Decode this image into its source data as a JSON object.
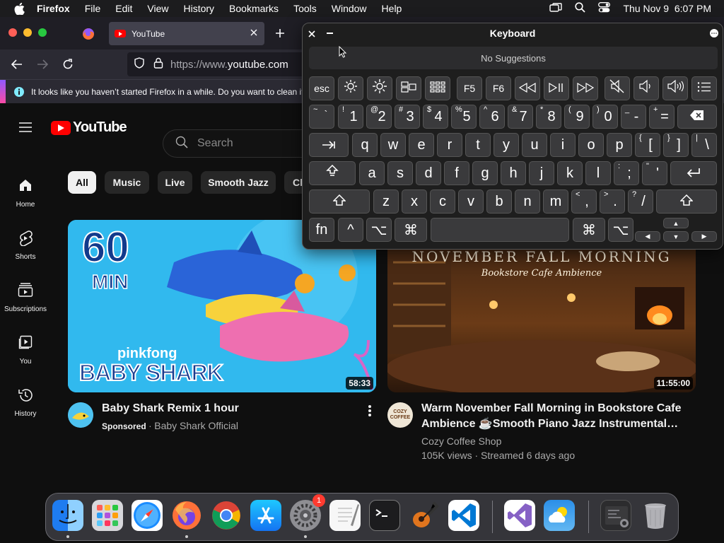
{
  "menubar": {
    "items": [
      "Firefox",
      "File",
      "Edit",
      "View",
      "History",
      "Bookmarks",
      "Tools",
      "Window",
      "Help"
    ],
    "clock": "Thu Nov 9  6:07 PM"
  },
  "browser": {
    "tab_title": "YouTube",
    "url_prefix": "https://www.",
    "url_domain": "youtube.com",
    "notification": "It looks like you haven’t started Firefox in a while. Do you want to clean it"
  },
  "youtube": {
    "logo_text": "YouTube",
    "search_placeholder": "Search",
    "sidebar": [
      {
        "label": "Home",
        "icon": "home-icon"
      },
      {
        "label": "Shorts",
        "icon": "shorts-icon"
      },
      {
        "label": "Subscriptions",
        "icon": "subscriptions-icon"
      },
      {
        "label": "You",
        "icon": "you-icon"
      },
      {
        "label": "History",
        "icon": "history-icon"
      }
    ],
    "chips": [
      "All",
      "Music",
      "Live",
      "Smooth Jazz",
      "Cl"
    ],
    "videos": [
      {
        "title": "Baby Shark Remix 1 hour",
        "badge": "Sponsored",
        "channel": "Baby Shark Official",
        "duration": "58:33",
        "thumb_line1": "60",
        "thumb_line2": "MIN",
        "thumb_brand": "pinkfong",
        "thumb_title": "BABY SHARK"
      },
      {
        "title_line1": "Warm November Fall Morning in Bookstore Cafe",
        "title_line2": "Ambience ☕Smooth Piano Jazz Instrumental…",
        "channel": "Cozy Coffee Shop",
        "views": "105K views",
        "streamed": "Streamed 6 days ago",
        "duration": "11:55:00",
        "thumb_title": "NOVEMBER FALL MORNING",
        "thumb_subtitle": "Bookstore Cafe Ambience",
        "avatar_text": "COZY COFFEE"
      }
    ]
  },
  "keyboard": {
    "title": "Keyboard",
    "suggestions": "No Suggestions",
    "fn_row": [
      "esc",
      "F5",
      "F6"
    ],
    "num_row": [
      {
        "p": "1",
        "s": "!"
      },
      {
        "p": "2",
        "s": "@"
      },
      {
        "p": "3",
        "s": "#"
      },
      {
        "p": "4",
        "s": "$"
      },
      {
        "p": "5",
        "s": "%"
      },
      {
        "p": "6",
        "s": "^"
      },
      {
        "p": "7",
        "s": "&"
      },
      {
        "p": "8",
        "s": "*"
      },
      {
        "p": "9",
        "s": "("
      },
      {
        "p": "0",
        "s": ")"
      },
      {
        "p": "-",
        "s": "_"
      },
      {
        "p": "=",
        "s": "+"
      }
    ],
    "backtick": {
      "p": "`",
      "s": "~"
    },
    "row_q": [
      "q",
      "w",
      "e",
      "r",
      "t",
      "y",
      "u",
      "i",
      "o",
      "p"
    ],
    "row_q_extra": [
      {
        "p": "[",
        "s": "{"
      },
      {
        "p": "]",
        "s": "}"
      },
      {
        "p": "\\",
        "s": "|"
      }
    ],
    "row_a": [
      "a",
      "s",
      "d",
      "f",
      "g",
      "h",
      "j",
      "k",
      "l"
    ],
    "row_a_extra": [
      {
        "p": ";",
        "s": ":"
      },
      {
        "p": "'",
        "s": "\""
      }
    ],
    "row_z": [
      "z",
      "x",
      "c",
      "v",
      "b",
      "n",
      "m"
    ],
    "row_z_extra": [
      {
        "p": ",",
        "s": "<"
      },
      {
        "p": ".",
        "s": ">"
      },
      {
        "p": "/",
        "s": "?"
      }
    ],
    "bottom": {
      "fn": "fn",
      "ctrl": "^",
      "opt": "⌥",
      "cmd": "⌘"
    },
    "arrows": [
      "▲",
      "◀",
      "▼",
      "▶"
    ]
  },
  "dock": {
    "apps": [
      "finder-icon",
      "launchpad-icon",
      "safari-icon",
      "firefox-icon",
      "chrome-icon",
      "app-store-icon",
      "system-settings-icon",
      "textedit-icon",
      "terminal-icon",
      "garageband-icon",
      "vscode-icon",
      "visual-studio-icon",
      "weather-icon",
      "screenshot-icon",
      "trash-icon"
    ],
    "settings_badge": "1"
  }
}
